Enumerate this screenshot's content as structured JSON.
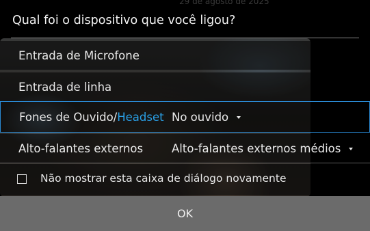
{
  "background": {
    "date_text": "29 de agosto de 2025"
  },
  "dialog": {
    "title": "Qual foi o dispositivo que você ligou?",
    "options": {
      "microphone": "Entrada de Microfone",
      "line_in": "Entrada de linha",
      "headset_prefix": "Fones de Ouvido/",
      "headset_accent": "Headset",
      "speakers": "Alto-falantes externos"
    },
    "headset_dropdown": {
      "value": "No ouvido",
      "icon": "caret-down-icon"
    },
    "speakers_dropdown": {
      "value": "Alto-falantes externos médios",
      "icon": "caret-down-icon"
    },
    "dont_show_label": "Não mostrar esta caixa de diálogo novamente",
    "dont_show_checked": false,
    "ok_label": "OK"
  },
  "colors": {
    "accent": "#2aa0e6",
    "ok_bar": "#6b6b6b",
    "background": "#000000"
  }
}
